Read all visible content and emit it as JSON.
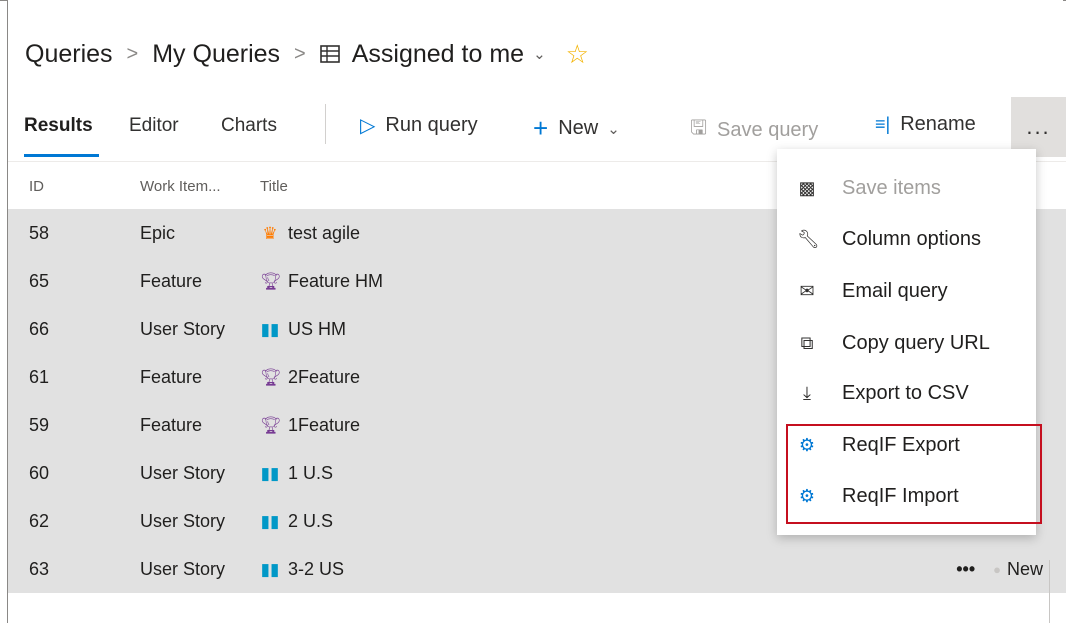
{
  "breadcrumb": {
    "items": [
      "Queries",
      "My Queries"
    ],
    "current": "Assigned to me",
    "separator": ">"
  },
  "tabs": [
    "Results",
    "Editor",
    "Charts"
  ],
  "toolbar": {
    "run_query": "Run query",
    "new": "New",
    "save_query": "Save query",
    "rename": "Rename",
    "more": "..."
  },
  "columns": {
    "id": "ID",
    "work_item_type": "Work Item...",
    "title": "Title"
  },
  "rows": [
    {
      "id": "58",
      "type": "Epic",
      "title": "test agile",
      "icon": "crown-icon"
    },
    {
      "id": "65",
      "type": "Feature",
      "title": "Feature HM",
      "icon": "trophy-icon"
    },
    {
      "id": "66",
      "type": "User Story",
      "title": "US HM",
      "icon": "book-icon"
    },
    {
      "id": "61",
      "type": "Feature",
      "title": "2Feature",
      "icon": "trophy-icon"
    },
    {
      "id": "59",
      "type": "Feature",
      "title": "1Feature",
      "icon": "trophy-icon"
    },
    {
      "id": "60",
      "type": "User Story",
      "title": "1 U.S",
      "icon": "book-icon"
    },
    {
      "id": "62",
      "type": "User Story",
      "title": "2 U.S",
      "icon": "book-icon"
    },
    {
      "id": "63",
      "type": "User Story",
      "title": "3-2 US",
      "icon": "book-icon"
    }
  ],
  "last_row_actions": {
    "more": "•••",
    "state": "New"
  },
  "menu": {
    "items": [
      {
        "label": "Save items",
        "icon": "save-items-icon",
        "disabled": true
      },
      {
        "label": "Column options",
        "icon": "wrench-icon",
        "disabled": false
      },
      {
        "label": "Email query",
        "icon": "mail-icon",
        "disabled": false
      },
      {
        "label": "Copy query URL",
        "icon": "copy-icon",
        "disabled": false
      },
      {
        "label": "Export to CSV",
        "icon": "download-icon",
        "disabled": false
      },
      {
        "label": "ReqIF Export",
        "icon": "reqif-export-icon",
        "disabled": false
      },
      {
        "label": "ReqIF Import",
        "icon": "reqif-import-icon",
        "disabled": false
      }
    ]
  },
  "colors": {
    "accent": "#0078d4",
    "epic": "#ff7b00",
    "feature": "#773b93",
    "story": "#0098c7",
    "highlight_border": "#c50f1f",
    "row_selected": "#e1e1e1",
    "star": "#f3b300"
  }
}
